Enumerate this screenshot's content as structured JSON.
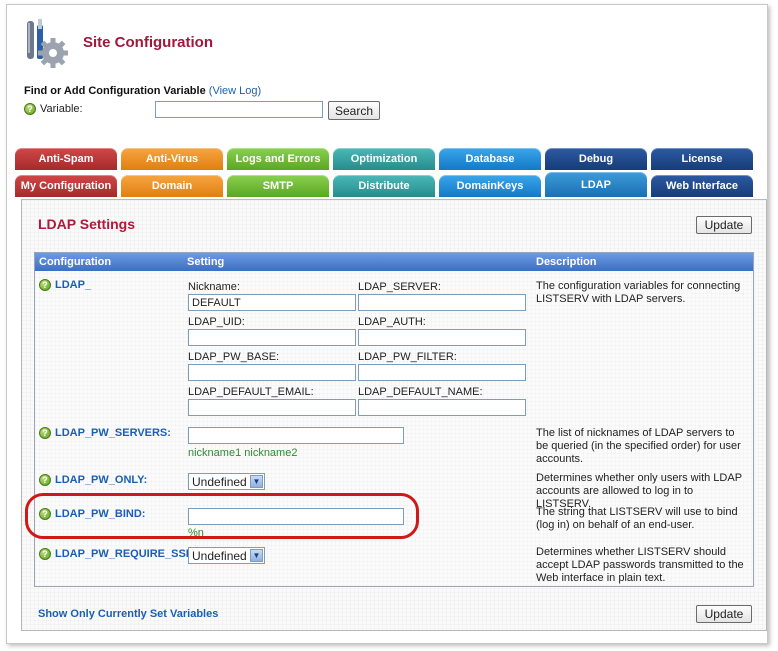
{
  "header": {
    "title": "Site Configuration",
    "find_label": "Find or Add Configuration Variable",
    "view_log_link": "(View Log)",
    "variable_label": "Variable:",
    "variable_value": "",
    "search_button": "Search"
  },
  "tabs_row1": [
    {
      "label": "Anti-Spam",
      "color": "#b83535"
    },
    {
      "label": "Anti-Virus",
      "color": "#ee9226"
    },
    {
      "label": "Logs and Errors",
      "color": "#6ebc38"
    },
    {
      "label": "Optimization",
      "color": "#33a2a2"
    },
    {
      "label": "Database",
      "color": "#2590d9"
    },
    {
      "label": "Debug",
      "color": "#1f4a8f"
    },
    {
      "label": "License",
      "color": "#1f4a8f"
    }
  ],
  "tabs_row2": [
    {
      "label": "My Configuration",
      "color": "#b83535"
    },
    {
      "label": "Domain",
      "color": "#ee9226"
    },
    {
      "label": "SMTP",
      "color": "#6ebc38"
    },
    {
      "label": "Distribute",
      "color": "#33a2a2"
    },
    {
      "label": "DomainKeys",
      "color": "#2590d9"
    },
    {
      "label": "LDAP",
      "color": "#2590d9",
      "active": true
    },
    {
      "label": "Web Interface",
      "color": "#1f4a8f"
    }
  ],
  "panel": {
    "title": "LDAP Settings",
    "update_button": "Update",
    "footer_link": "Show Only Currently Set Variables"
  },
  "table": {
    "headers": {
      "configuration": "Configuration",
      "setting": "Setting",
      "description": "Description"
    },
    "rows": {
      "ldap": {
        "name": "LDAP_",
        "fields": {
          "nickname_label": "Nickname:",
          "nickname_value": "DEFAULT",
          "server_label": "LDAP_SERVER:",
          "server_value": "",
          "uid_label": "LDAP_UID:",
          "uid_value": "",
          "auth_label": "LDAP_AUTH:",
          "auth_value": "",
          "pw_base_label": "LDAP_PW_BASE:",
          "pw_base_value": "",
          "pw_filter_label": "LDAP_PW_FILTER:",
          "pw_filter_value": "",
          "default_email_label": "LDAP_DEFAULT_EMAIL:",
          "default_email_value": "",
          "default_name_label": "LDAP_DEFAULT_NAME:",
          "default_name_value": ""
        },
        "description": "The configuration variables for connecting LISTSERV with LDAP servers."
      },
      "pw_servers": {
        "name": "LDAP_PW_SERVERS:",
        "value": "",
        "hint": "nickname1 nickname2",
        "description": "The list of nicknames of LDAP servers to be queried (in the specified order) for user accounts."
      },
      "pw_only": {
        "name": "LDAP_PW_ONLY:",
        "value": "Undefined",
        "description": "Determines whether only users with LDAP accounts are allowed to log in to LISTSERV."
      },
      "pw_bind": {
        "name": "LDAP_PW_BIND:",
        "value": "",
        "hint": "%n",
        "description": "The string that LISTSERV will use to bind (log in) on behalf of an end-user."
      },
      "pw_require_ssl": {
        "name": "LDAP_PW_REQUIRE_SSL:",
        "value": "Undefined",
        "description": "Determines whether LISTSERV should accept LDAP passwords transmitted to the Web interface in plain text."
      }
    }
  },
  "icons": {
    "logo": "tools-gear-icon",
    "help": "help-icon",
    "dropdown": "chevron-down-icon"
  },
  "colors": {
    "title_red": "#a0183c",
    "link_blue": "#1a5fb4",
    "hint_green": "#2e8b2e",
    "highlight_red": "#d01818",
    "table_header_blue": "#4a7fd0"
  }
}
